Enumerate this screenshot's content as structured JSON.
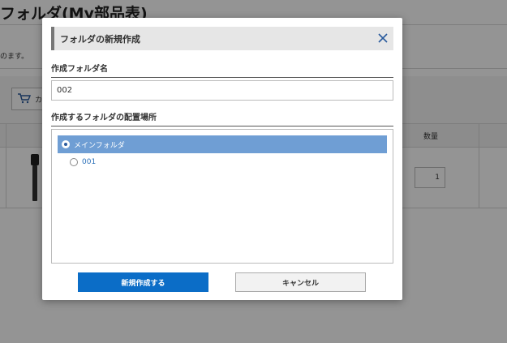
{
  "background": {
    "page_title": "フォルダ(My部品表)",
    "description": "のます。",
    "toolbar_button_label": "カ",
    "column_quantity": "数量",
    "row_quantity_value": "1"
  },
  "modal": {
    "title": "フォルダの新規作成",
    "name_label": "作成フォルダ名",
    "name_value": "002",
    "location_label": "作成するフォルダの配置場所",
    "locations": [
      {
        "label": "メインフォルダ",
        "selected": true
      },
      {
        "label": "001",
        "selected": false
      }
    ],
    "create_button": "新規作成する",
    "cancel_button": "キャンセル"
  },
  "colors": {
    "primary": "#0b6dc7",
    "selected_row": "#6f9ed4",
    "link": "#2a6fb8",
    "close_icon": "#2b5c9e"
  }
}
